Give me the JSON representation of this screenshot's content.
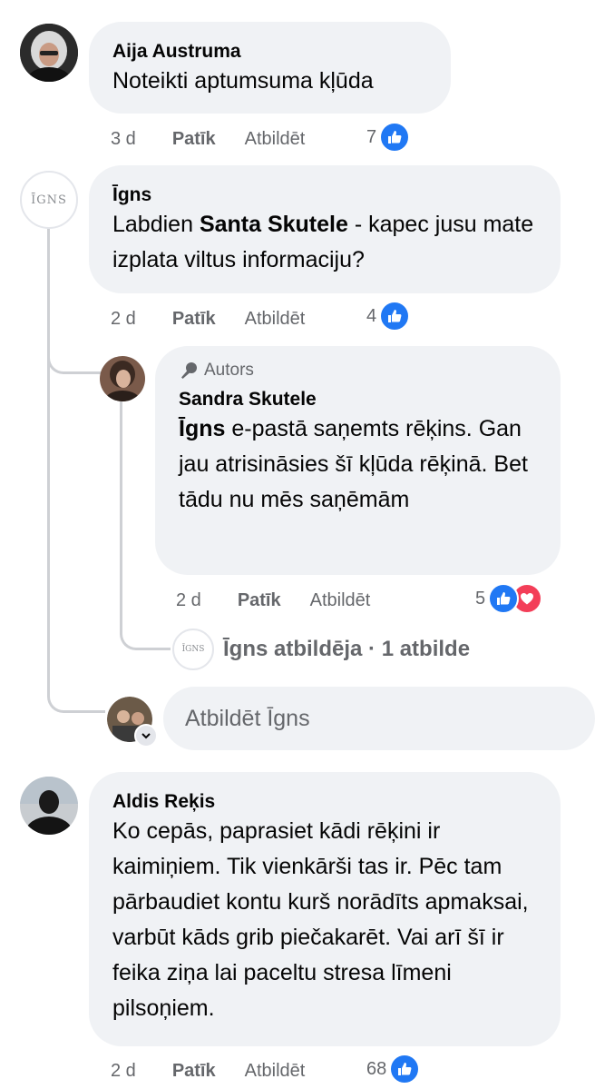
{
  "comments": [
    {
      "author": "Aija Austruma",
      "text": "Noteikti aptumsuma kļūda",
      "time": "3 d",
      "like_label": "Patīk",
      "reply_label": "Atbildēt",
      "reaction_count": "7"
    },
    {
      "author": "Īgns",
      "avatar_text": "ĪGNS",
      "text_before": "Labdien ",
      "mention": "Santa Skutele",
      "text_after": " - kapec jusu mate izplata viltus informaciju?",
      "time": "2 d",
      "like_label": "Patīk",
      "reply_label": "Atbildēt",
      "reaction_count": "4",
      "reply": {
        "author_badge": "Autors",
        "author": "Sandra Skutele",
        "mention": "Īgns",
        "text": " e-pastā saņemts rēķins. Gan jau atrisināsies šī kļūda rēķinā. Bet tādu nu mēs saņēmām",
        "time": "2 d",
        "like_label": "Patīk",
        "reply_label": "Atbildēt",
        "reaction_count": "5",
        "replies_link": "Īgns atbildēja · 1 atbilde",
        "replies_avatar_text": "ĪGNS"
      },
      "reply_input_placeholder": "Atbildēt Īgns"
    },
    {
      "author": "Aldis Reķis",
      "text": "Ko cepās, paprasiet kādi rēķini ir kaimiņiem. Tik vienkārši tas ir. Pēc tam pārbaudiet kontu kurš norādīts apmaksai, varbūt kāds grib piečakarēt. Vai arī šī ir feika ziņa lai paceltu stresa līmeni pilsoņiem.",
      "time": "2 d",
      "like_label": "Patīk",
      "reply_label": "Atbildēt",
      "reaction_count": "68"
    }
  ],
  "colors": {
    "bubble_bg": "#f0f2f5",
    "meta_text": "#65676b",
    "like_blue": "#2078f4",
    "love_red": "#f33e58",
    "thread_line": "#ced0d4"
  }
}
